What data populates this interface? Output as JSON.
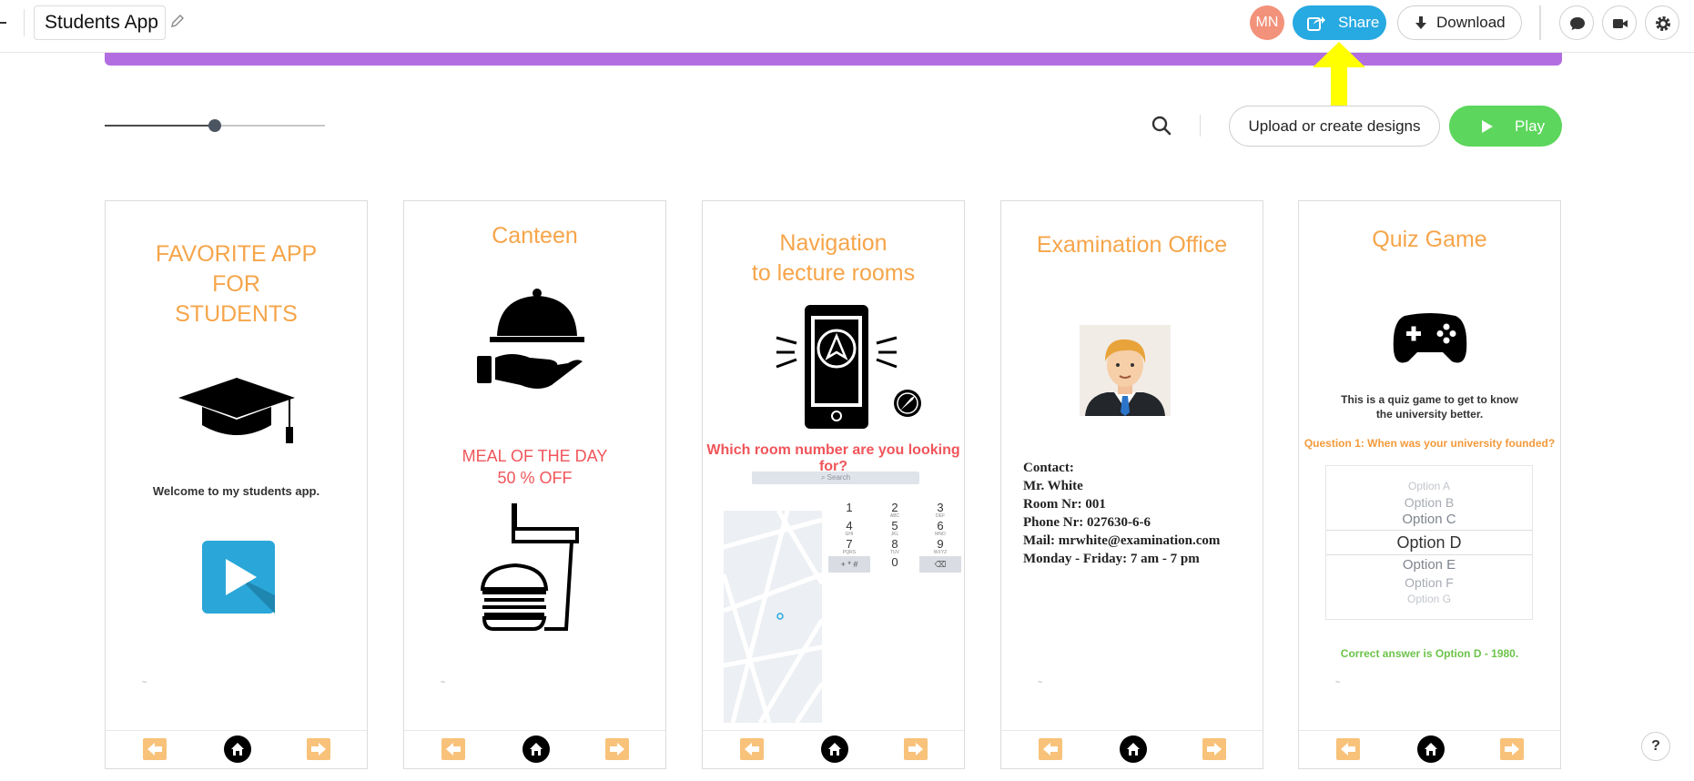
{
  "header": {
    "back_label": "",
    "app_title": "Students App",
    "avatar_initials": "MN",
    "share_label": "Share",
    "download_label": "Download"
  },
  "toolbar": {
    "zoom_level": 0.5,
    "upload_label": "Upload or create designs",
    "play_label": "Play"
  },
  "colors": {
    "accent_purple": "#b26de0",
    "share_blue": "#27a9e1",
    "play_green": "#5cd65c",
    "title_orange": "#f6a54a",
    "promo_red": "#f0555a",
    "quiz_orange": "#f39a3b",
    "answer_green": "#6cc34a",
    "annotation_yellow": "#ffff00"
  },
  "screens": [
    {
      "title_lines": [
        "FAVORITE APP",
        "FOR",
        "STUDENTS"
      ],
      "icon": "graduation-cap-icon",
      "tagline": "Welcome to my students app.",
      "video_icon": "play-video-icon",
      "tilde": "~"
    },
    {
      "title": "Canteen",
      "icon": "food-serving-cloche-icon",
      "promo_lines": [
        "MEAL OF THE DAY",
        "50 % OFF"
      ],
      "food_icon": "burger-and-drink-icon",
      "tilde": "~"
    },
    {
      "title_lines": [
        "Navigation",
        "to lecture rooms"
      ],
      "icon": "phone-navigation-icon",
      "question": "Which room number are you looking for?",
      "search_placeholder": "Search",
      "keypad": [
        {
          "num": "1",
          "sub": ""
        },
        {
          "num": "2",
          "sub": "ABC"
        },
        {
          "num": "3",
          "sub": "DEF"
        },
        {
          "num": "4",
          "sub": "GHI"
        },
        {
          "num": "5",
          "sub": "JKL"
        },
        {
          "num": "6",
          "sub": "MNO"
        },
        {
          "num": "7",
          "sub": "PQRS"
        },
        {
          "num": "8",
          "sub": "TUV"
        },
        {
          "num": "9",
          "sub": "WXYZ"
        },
        {
          "num": "+ * #",
          "sub": ""
        },
        {
          "num": "0",
          "sub": ""
        },
        {
          "num": "⌫",
          "sub": ""
        }
      ]
    },
    {
      "title": "Examination Office",
      "icon": "officer-portrait",
      "contact_lines": [
        "Contact:",
        "Mr. White",
        "Room Nr: 001",
        "Phone Nr: 027630-6-6",
        "Mail: mrwhite@examination.com",
        "Monday - Friday: 7 am - 7 pm"
      ],
      "tilde": "~"
    },
    {
      "title": "Quiz Game",
      "icon": "gamepad-icon",
      "description_lines": [
        "This is a quiz game to get to know",
        "the university better."
      ],
      "question": "Question 1: When was your university founded?",
      "options": [
        "Option A",
        "Option B",
        "Option C",
        "Option D",
        "Option E",
        "Option F",
        "Option G"
      ],
      "selected_option": "Option D",
      "answer": "Correct answer is Option D - 1980.",
      "tilde": "~"
    }
  ],
  "help_label": "?"
}
